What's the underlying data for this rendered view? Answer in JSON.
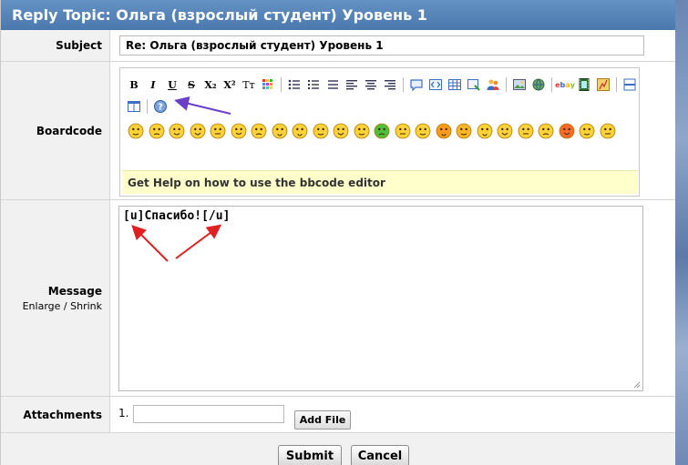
{
  "window": {
    "title": "Reply Topic: Ольга (взрослый студент) Уровень 1"
  },
  "subject": {
    "label": "Subject",
    "value": "Re: Ольга (взрослый студент) Уровень 1"
  },
  "boardcode": {
    "label": "Boardcode",
    "toolbar_text": {
      "bold": "B",
      "italic": "I",
      "underline": "U",
      "strike": "S",
      "sub": "X₂",
      "sup": "X²",
      "font": "Tт"
    },
    "help_text": "Get Help on how to use the bbcode editor"
  },
  "message": {
    "label": "Message",
    "enlarge": "Enlarge",
    "slash": "/",
    "shrink": "Shrink",
    "value": "[u]Спасибо![/u]"
  },
  "attachments": {
    "label": "Attachments",
    "number": "1.",
    "add_file": "Add File"
  },
  "actions": {
    "submit": "Submit",
    "cancel": "Cancel"
  },
  "colors": {
    "titlebar": "#4e7db4",
    "help_bg": "#ffffcc",
    "arrow_red": "#e02020",
    "arrow_purple": "#6a3fc9"
  }
}
